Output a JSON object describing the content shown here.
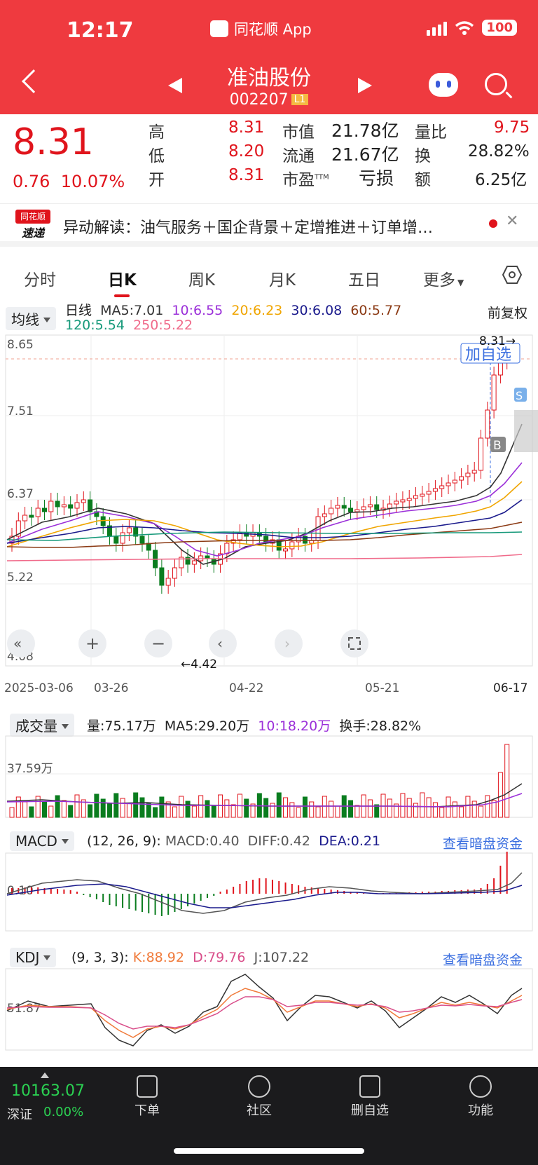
{
  "status_bar": {
    "time": "12:17",
    "app_name": "同花顺 App",
    "battery": "100"
  },
  "header": {
    "stock_name": "准油股份",
    "stock_code": "002207",
    "level_badge": "L1"
  },
  "quote": {
    "price": "8.31",
    "change": "0.76",
    "change_pct": "10.07%",
    "high_label": "高",
    "high": "8.31",
    "low_label": "低",
    "low": "8.20",
    "open_label": "开",
    "open": "8.31",
    "mktcap_label": "市值",
    "mktcap": "21.78亿",
    "float_label": "流通",
    "float": "21.67亿",
    "pe_label": "市盈",
    "pe_sup": "TTM",
    "pe": "亏损",
    "vol_ratio_label": "量比",
    "vol_ratio": "9.75",
    "turnover_label": "换",
    "turnover": "28.82%",
    "amount_label": "额",
    "amount": "6.25亿"
  },
  "news": {
    "logo_top": "同花顺",
    "logo_bottom": "速递",
    "text": "异动解读：油气服务＋国企背景＋定增推进＋订单增…"
  },
  "tabs": [
    "分时",
    "日K",
    "周K",
    "月K",
    "五日",
    "更多"
  ],
  "kline": {
    "indicator_select": "均线",
    "period": "日线",
    "ma5": "MA5:7.01",
    "ma10": "10:6.55",
    "ma20": "20:6.23",
    "ma30": "30:6.08",
    "ma60": "60:5.77",
    "ma120": "120:5.54",
    "ma250": "250:5.22",
    "adjust": "前复权",
    "y_labels": [
      "8.65",
      "7.51",
      "6.37",
      "5.22",
      "4.08"
    ],
    "high_marker": "8.31→",
    "low_marker": "←4.42",
    "add_watch": "加自选",
    "buy_marker": "B",
    "sell_marker": "S",
    "x_labels": [
      "2025-03-06",
      "03-26",
      "04-22",
      "05-21",
      "06-17"
    ]
  },
  "volume": {
    "select": "成交量",
    "vol": "量:75.17万",
    "ma5": "MA5:29.20万",
    "ma10": "10:18.20万",
    "turnover": "换手:28.82%",
    "y_label": "37.59万"
  },
  "macd": {
    "select": "MACD",
    "params": "(12, 26, 9):",
    "macd": "MACD:0.40",
    "diff": "DIFF:0.42",
    "dea": "DEA:0.21",
    "link": "查看暗盘资金",
    "y_label": "0.10"
  },
  "kdj": {
    "select": "KDJ",
    "params": "(9, 3, 3):",
    "k": "K:88.92",
    "d": "D:79.76",
    "j": "J:107.22",
    "link": "查看暗盘资金",
    "y_label": "51.87"
  },
  "bottom_bar": {
    "index_value": "10163.07",
    "index_name": "深证",
    "index_change": "0.00%",
    "items": [
      "下单",
      "社区",
      "删自选",
      "功能"
    ]
  },
  "colors": {
    "up": "#e0141c",
    "down": "#0a7d1f",
    "ma5": "#333333",
    "ma10": "#9b30d9",
    "ma20": "#f0a500",
    "ma30": "#1a1a8c",
    "ma60": "#8b3a14",
    "ma120": "#16997a",
    "ma250": "#f06a8a"
  }
}
